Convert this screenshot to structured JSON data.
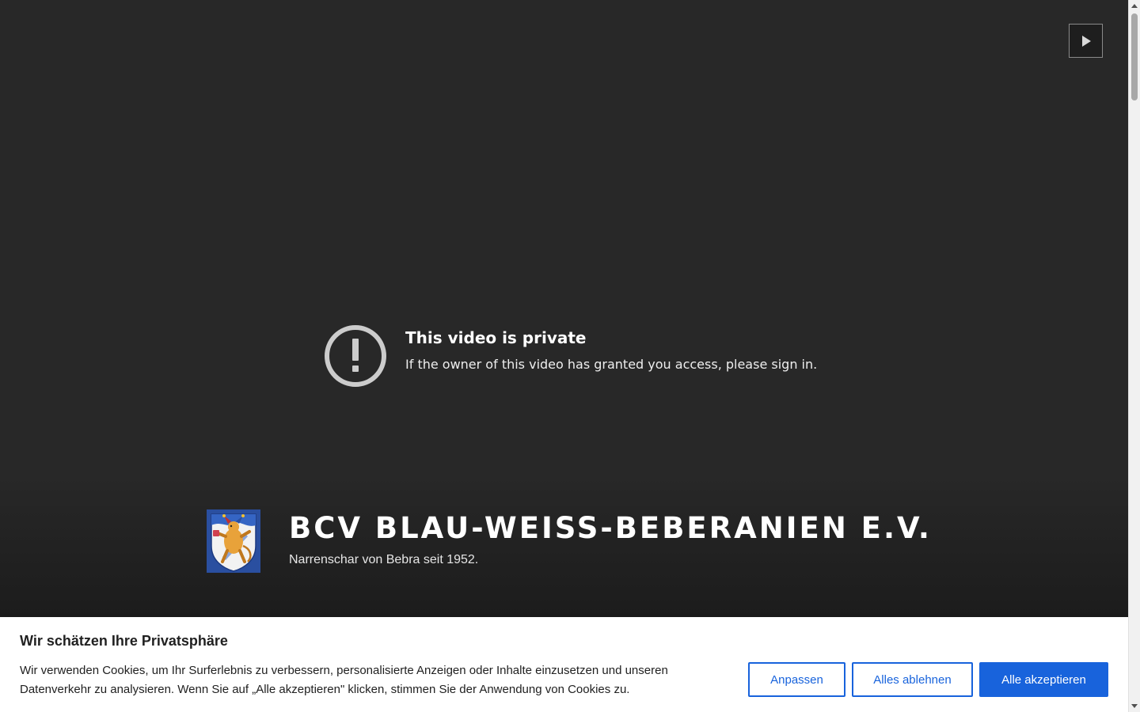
{
  "player": {
    "error_title": "This video is private",
    "error_subtitle": "If the owner of this video has granted you access, please sign in.",
    "icons": {
      "play": "play-icon",
      "alert": "alert-circle-icon"
    }
  },
  "site": {
    "title": "BCV BLAU-WEISS-BEBERANIEN E.V.",
    "description": "Narrenschar von Bebra seit 1952.",
    "logo": "club-crest-logo"
  },
  "cookie_banner": {
    "title": "Wir schätzen Ihre Privatsphäre",
    "text": "Wir verwenden Cookies, um Ihr Surferlebnis zu verbessern, personalisierte Anzeigen oder Inhalte einzusetzen und unseren Datenverkehr zu analysieren. Wenn Sie auf „Alle akzeptieren\" klicken, stimmen Sie der Anwendung von Cookies zu.",
    "buttons": {
      "customize": "Anpassen",
      "reject": "Alles ablehnen",
      "accept": "Alle akzeptieren"
    },
    "accent_color": "#1863dc"
  },
  "colors": {
    "background": "#282828",
    "banner_background": "#ffffff"
  }
}
